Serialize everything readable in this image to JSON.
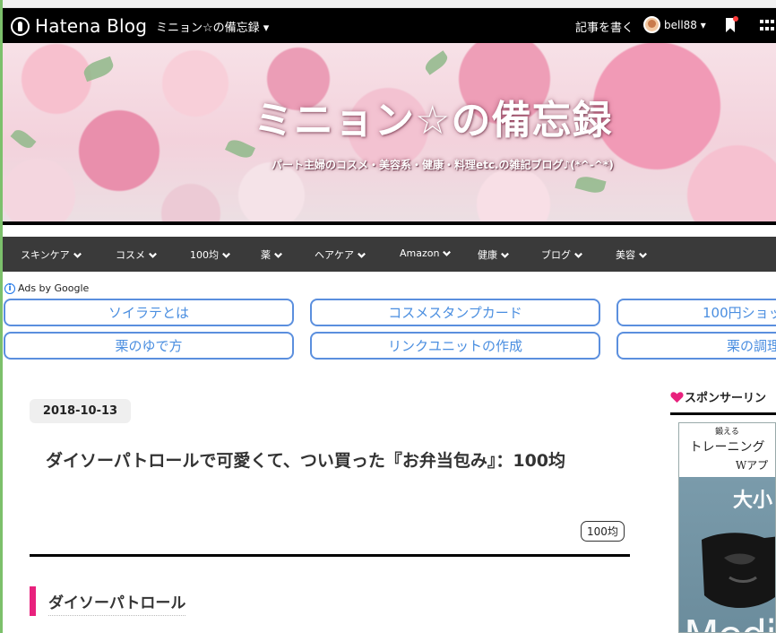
{
  "hatena_bar": {
    "logo_text": "Hatena Blog",
    "blog_switcher": "ミニョン☆の備忘録 ▾",
    "write_link": "記事を書く",
    "username": "bell88 ▾"
  },
  "header": {
    "title": "ミニョン☆の備忘録",
    "subtitle": "パート主婦のコスメ・美容系・健康・料理etc.の雑記ブログ♪(*^-^*)"
  },
  "nav": {
    "items": [
      {
        "label": "スキンケア"
      },
      {
        "label": "コスメ"
      },
      {
        "label": "100均"
      },
      {
        "label": "薬"
      },
      {
        "label": "ヘアケア"
      },
      {
        "label": "Amazon"
      },
      {
        "label": "健康"
      },
      {
        "label": "ブログ"
      },
      {
        "label": "美容"
      }
    ]
  },
  "ads": {
    "label": "Ads by Google",
    "links": [
      {
        "label": "ソイラテとは"
      },
      {
        "label": "コスメスタンプカード"
      },
      {
        "label": "100円ショッ"
      },
      {
        "label": "栗のゆで方"
      },
      {
        "label": "リンクユニットの作成"
      },
      {
        "label": "栗の調理"
      }
    ]
  },
  "article": {
    "date": "2018-10-13",
    "title": "ダイソーパトロールで可愛くて、つい買った『お弁当包み』：100均",
    "category": "100均",
    "section_heading": "ダイソーパトロール"
  },
  "sidebar": {
    "heading": "スポンサーリン",
    "ad": {
      "line1": "鍛える",
      "line2": "トレーニング",
      "line3": "Wアプ",
      "line4": "大小",
      "brand": "Medi"
    }
  },
  "colors": {
    "accent_pink": "#e8217d",
    "ad_link_blue": "#4a8ee0",
    "nav_bg": "#3a3a3a"
  }
}
